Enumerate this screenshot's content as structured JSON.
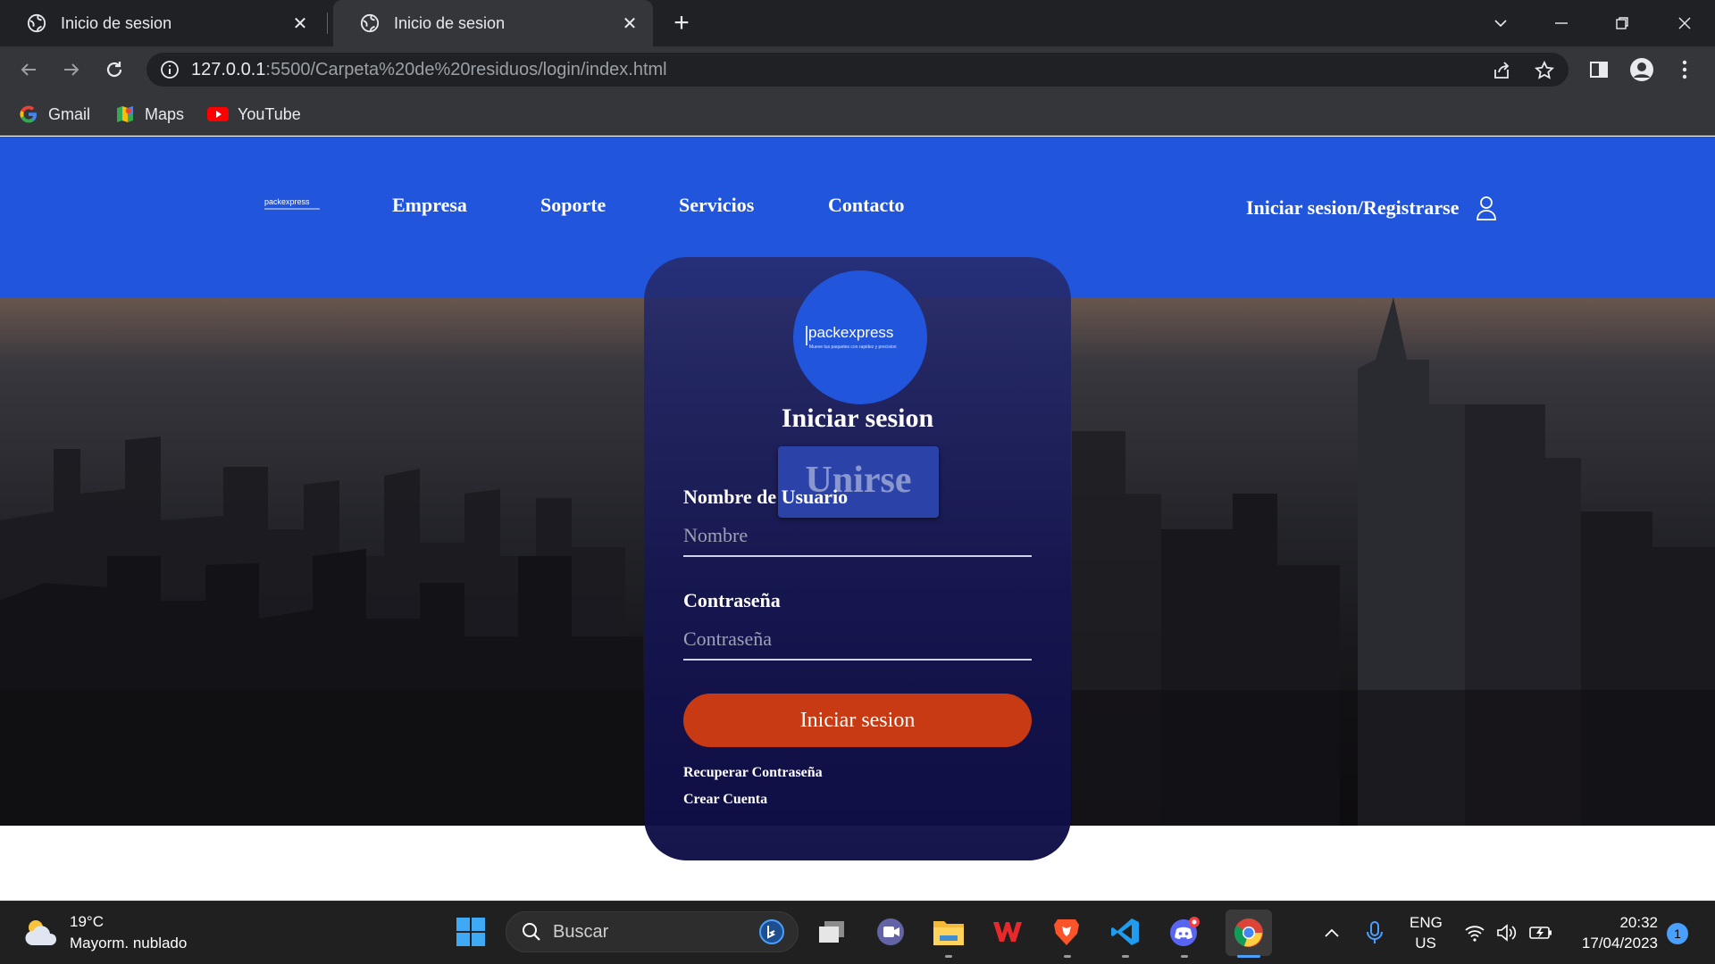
{
  "browser": {
    "tabs": [
      {
        "title": "Inicio de sesion",
        "active": false
      },
      {
        "title": "Inicio de sesion",
        "active": true
      }
    ],
    "url": {
      "host": "127.0.0.1",
      "rest": ":5500/Carpeta%20de%20residuos/login/index.html"
    },
    "bookmarks": [
      {
        "label": "Gmail",
        "icon": "google-icon"
      },
      {
        "label": "Maps",
        "icon": "maps-icon"
      },
      {
        "label": "YouTube",
        "icon": "youtube-icon"
      }
    ]
  },
  "site": {
    "logo": {
      "name": "packexpress",
      "slogan": "Mueve tus paquetes con rapidez y precision"
    },
    "nav": [
      "Empresa",
      "Soporte",
      "Servicios",
      "Contacto"
    ],
    "login_link": "Iniciar sesion/Registrarse"
  },
  "login": {
    "title": "Iniciar sesion",
    "join_tab": "Unirse",
    "username_label": "Nombre de Usuario",
    "username_placeholder": "Nombre",
    "password_label": "Contraseña",
    "password_placeholder": "Contraseña",
    "submit_label": "Iniciar sesion",
    "recover_link": "Recuperar Contraseña",
    "create_link": "Crear Cuenta"
  },
  "taskbar": {
    "weather": {
      "temp": "19°C",
      "condition": "Mayorm. nublado"
    },
    "search_placeholder": "Buscar",
    "lang": {
      "line1": "ENG",
      "line2": "US"
    },
    "time": "20:32",
    "date": "17/04/2023",
    "notification_count": "1"
  },
  "colors": {
    "site_header": "#2155db",
    "card_bg": "#161652",
    "login_button": "#c83a13",
    "browser_frame": "#202124"
  }
}
